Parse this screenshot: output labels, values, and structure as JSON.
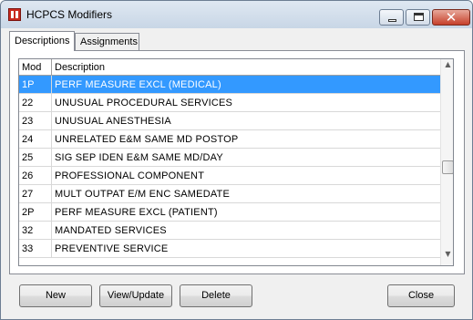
{
  "window": {
    "title": "HCPCS Modifiers",
    "close_glyph": "✕"
  },
  "tabs": [
    {
      "label": "Descriptions",
      "active": true
    },
    {
      "label": "Assignments",
      "active": false
    }
  ],
  "grid": {
    "columns": [
      "Mod",
      "Description"
    ],
    "rows": [
      {
        "mod": "1P",
        "description": "PERF MEASURE EXCL (MEDICAL)",
        "selected": true
      },
      {
        "mod": "22",
        "description": "UNUSUAL PROCEDURAL SERVICES"
      },
      {
        "mod": "23",
        "description": "UNUSUAL ANESTHESIA"
      },
      {
        "mod": "24",
        "description": "UNRELATED E&M SAME MD POSTOP"
      },
      {
        "mod": "25",
        "description": "SIG SEP IDEN E&M SAME MD/DAY"
      },
      {
        "mod": "26",
        "description": "PROFESSIONAL COMPONENT"
      },
      {
        "mod": "27",
        "description": "MULT OUTPAT E/M ENC SAMEDATE"
      },
      {
        "mod": "2P",
        "description": "PERF MEASURE EXCL (PATIENT)"
      },
      {
        "mod": "32",
        "description": "MANDATED SERVICES"
      },
      {
        "mod": "33",
        "description": "PREVENTIVE SERVICE"
      }
    ],
    "scroll_up_glyph": "▲",
    "scroll_down_glyph": "▼"
  },
  "buttons": {
    "new": "New",
    "view_update": "View/Update",
    "delete": "Delete",
    "close": "Close"
  },
  "colors": {
    "selection": "#3399ff",
    "icon_red": "#c92a1f"
  }
}
